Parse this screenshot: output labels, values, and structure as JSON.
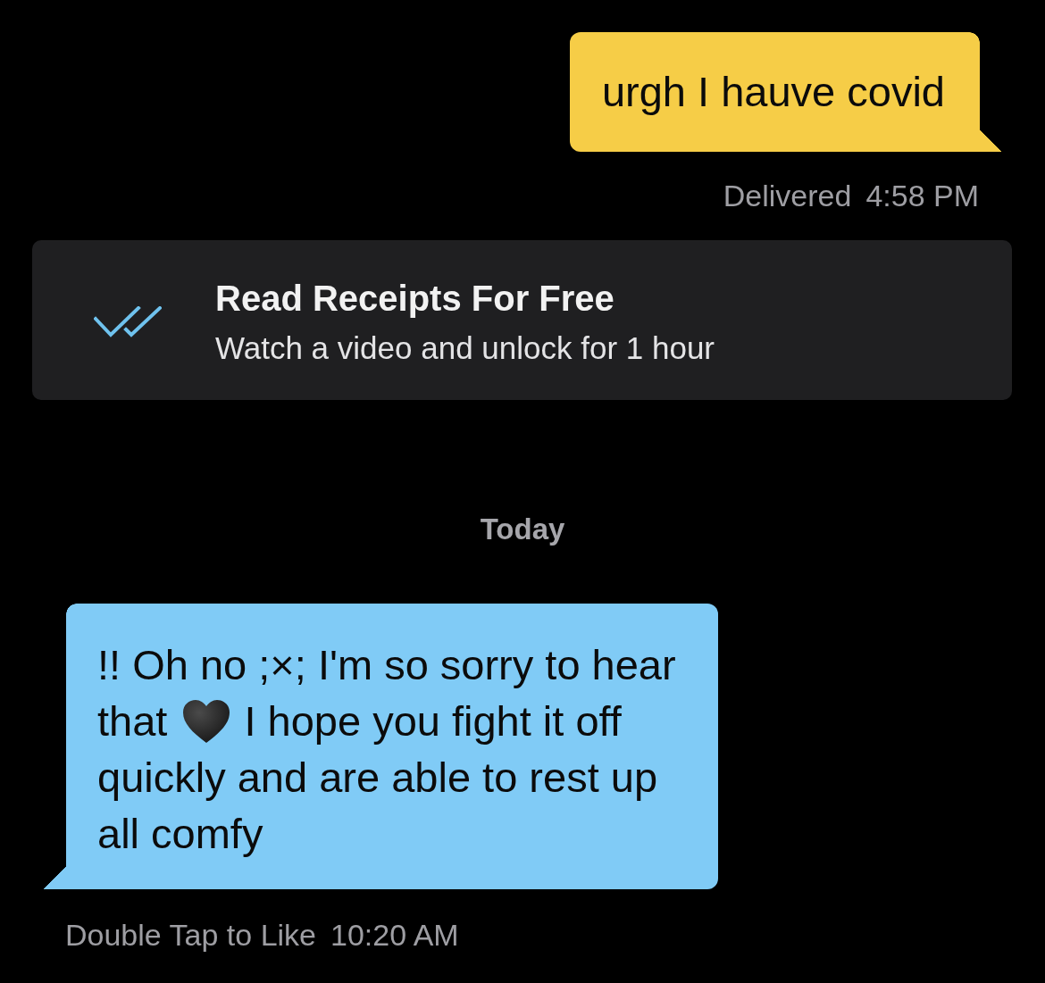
{
  "thread": [
    {
      "kind": "outgoing",
      "lines": [
        [
          {
            "kind": "text",
            "text": "urgh I hauve covid"
          }
        ]
      ],
      "status": "Delivered",
      "time": "4:58 PM"
    },
    {
      "kind": "promo",
      "title": "Read Receipts For Free",
      "subtitle": "Watch a video and unlock for 1 hour"
    },
    {
      "kind": "date",
      "label": "Today"
    },
    {
      "kind": "incoming",
      "lines": [
        [
          {
            "kind": "text",
            "text": "!! Oh no ;×; I'm so sorry to hear"
          }
        ],
        [
          {
            "kind": "text",
            "text": "that"
          },
          {
            "kind": "heart"
          },
          {
            "kind": "text",
            "text": "I hope you fight it off"
          }
        ],
        [
          {
            "kind": "text",
            "text": "quickly and are able to rest up"
          }
        ],
        [
          {
            "kind": "text",
            "text": "all comfy"
          }
        ]
      ],
      "hint": "Double Tap to Like",
      "time": "10:20 AM"
    }
  ]
}
